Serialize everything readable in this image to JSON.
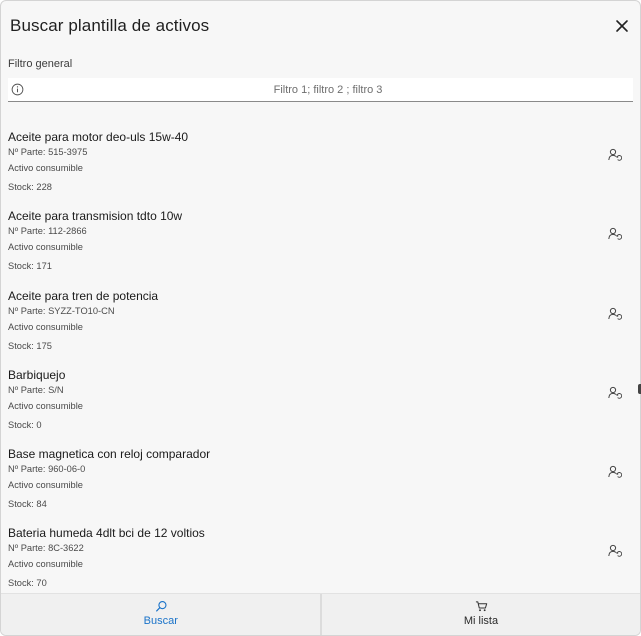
{
  "dialog": {
    "title": "Buscar plantilla de activos",
    "close_icon": "close-icon"
  },
  "filter": {
    "label": "Filtro general",
    "placeholder": "Filtro 1; filtro 2 ; filtro 3",
    "value": "",
    "icon": "info-icon"
  },
  "items": [
    {
      "name": "Aceite para motor deo-uls 15w-40",
      "part": "Nº Parte: 515-3975",
      "type": "Activo consumible",
      "stock": "Stock: 228"
    },
    {
      "name": "Aceite para transmision tdto 10w",
      "part": "Nº Parte: 112-2866",
      "type": "Activo consumible",
      "stock": "Stock: 171"
    },
    {
      "name": "Aceite para tren de potencia",
      "part": "Nº Parte: SYZZ-TO10-CN",
      "type": "Activo consumible",
      "stock": "Stock: 175"
    },
    {
      "name": "Barbiquejo",
      "part": "Nº Parte: S/N",
      "type": "Activo consumible",
      "stock": "Stock: 0"
    },
    {
      "name": "Base magnetica con reloj comparador",
      "part": "Nº Parte: 960-06-0",
      "type": "Activo consumible",
      "stock": "Stock: 84"
    },
    {
      "name": "Bateria humeda 4dlt bci de 12 voltios",
      "part": "Nº Parte: 8C-3622",
      "type": "Activo consumible",
      "stock": "Stock: 70"
    }
  ],
  "footer": {
    "search_tab": {
      "label": "Buscar",
      "icon": "search-icon",
      "color": "#1a73c9"
    },
    "list_tab": {
      "label": "Mi lista",
      "icon": "cart-icon"
    }
  }
}
